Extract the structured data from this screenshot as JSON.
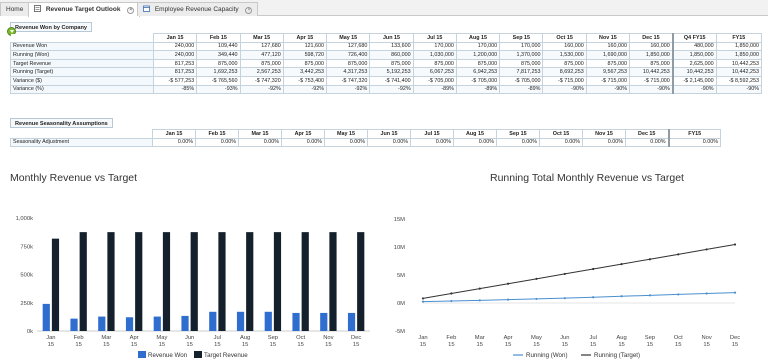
{
  "tabs": [
    {
      "label": "Home"
    },
    {
      "label": "Revenue Target Outlook"
    },
    {
      "label": "Employee Revenue Capacity"
    }
  ],
  "table1": {
    "title": "Revenue Won by Company",
    "columns": [
      "Jan 15",
      "Feb 15",
      "Mar 15",
      "Apr 15",
      "May 15",
      "Jun 15",
      "Jul 15",
      "Aug 15",
      "Sep 15",
      "Oct 15",
      "Nov 15",
      "Dec 15",
      "Q4 FY15",
      "FY15"
    ],
    "rows": [
      {
        "label": "Revenue Won",
        "values": [
          "240,000",
          "109,440",
          "127,680",
          "121,600",
          "127,680",
          "133,600",
          "170,000",
          "170,000",
          "170,000",
          "160,000",
          "160,000",
          "160,000",
          "480,000",
          "1,850,000"
        ]
      },
      {
        "label": "Running (Won)",
        "values": [
          "240,000",
          "349,440",
          "477,120",
          "598,720",
          "726,400",
          "860,000",
          "1,030,000",
          "1,200,000",
          "1,370,000",
          "1,530,000",
          "1,690,000",
          "1,850,000",
          "1,850,000",
          "1,850,000"
        ]
      },
      {
        "label": "Target Revenue",
        "values": [
          "817,253",
          "875,000",
          "875,000",
          "875,000",
          "875,000",
          "875,000",
          "875,000",
          "875,000",
          "875,000",
          "875,000",
          "875,000",
          "875,000",
          "2,625,000",
          "10,442,253"
        ]
      },
      {
        "label": "Running (Target)",
        "values": [
          "817,253",
          "1,692,253",
          "2,567,253",
          "3,442,253",
          "4,317,253",
          "5,192,253",
          "6,067,253",
          "6,942,253",
          "7,817,253",
          "8,692,253",
          "9,567,253",
          "10,442,253",
          "10,442,253",
          "10,442,253"
        ]
      },
      {
        "label": "Variance ($)",
        "values": [
          "-$ 577,253",
          "-$ 765,560",
          "-$ 747,320",
          "-$ 753,400",
          "-$ 747,320",
          "-$ 741,400",
          "-$ 705,000",
          "-$ 705,000",
          "-$ 705,000",
          "-$ 715,000",
          "-$ 715,000",
          "-$ 715,000",
          "-$ 2,145,000",
          "-$ 8,592,253"
        ]
      },
      {
        "label": "Variance (%)",
        "values": [
          "-85%",
          "-93%",
          "-92%",
          "-92%",
          "-92%",
          "-92%",
          "-89%",
          "-89%",
          "-89%",
          "-90%",
          "-90%",
          "-90%",
          "-90%",
          "-90%"
        ]
      }
    ]
  },
  "table2": {
    "title": "Revenue Seasonality Assumptions",
    "columns": [
      "Jan 15",
      "Feb 15",
      "Mar 15",
      "Apr 15",
      "May 15",
      "Jun 15",
      "Jul 15",
      "Aug 15",
      "Sep 15",
      "Oct 15",
      "Nov 15",
      "Dec 15",
      "FY15"
    ],
    "rows": [
      {
        "label": "Seasonality Adjustment",
        "values": [
          "0.00%",
          "0.00%",
          "0.00%",
          "0.00%",
          "0.00%",
          "0.00%",
          "0.00%",
          "0.00%",
          "0.00%",
          "0.00%",
          "0.00%",
          "0.00%",
          "0.00%"
        ]
      }
    ]
  },
  "chart_data": [
    {
      "type": "bar",
      "title": "Monthly Revenue vs Target",
      "categories": [
        "Jan 15",
        "Feb 15",
        "Mar 15",
        "Apr 15",
        "May 15",
        "Jun 15",
        "Jul 15",
        "Aug 15",
        "Sep 15",
        "Oct 15",
        "Nov 15",
        "Dec 15"
      ],
      "series": [
        {
          "name": "Revenue Won",
          "color": "#2f6ecf",
          "values": [
            240000,
            109440,
            127680,
            121600,
            127680,
            133600,
            170000,
            170000,
            170000,
            160000,
            160000,
            160000
          ]
        },
        {
          "name": "Target Revenue",
          "color": "#14202b",
          "values": [
            817253,
            875000,
            875000,
            875000,
            875000,
            875000,
            875000,
            875000,
            875000,
            875000,
            875000,
            875000
          ]
        }
      ],
      "ylim": [
        0,
        1000000
      ],
      "yticks": [
        "0k",
        "250k",
        "500k",
        "750k",
        "1,000k"
      ],
      "legend": "bottom"
    },
    {
      "type": "line",
      "title": "Running Total Monthly Revenue vs Target",
      "categories": [
        "Jan 15",
        "Feb 15",
        "Mar 15",
        "Apr 15",
        "May 15",
        "Jun 15",
        "Jul 15",
        "Aug 15",
        "Sep 15",
        "Oct 15",
        "Nov 15",
        "Dec 15"
      ],
      "series": [
        {
          "name": "Running (Won)",
          "color": "#4a8fcf",
          "values": [
            240000,
            349440,
            477120,
            598720,
            726400,
            860000,
            1030000,
            1200000,
            1370000,
            1530000,
            1690000,
            1850000
          ]
        },
        {
          "name": "Running (Target)",
          "color": "#333333",
          "values": [
            817253,
            1692253,
            2567253,
            3442253,
            4317253,
            5192253,
            6067253,
            6942253,
            7817253,
            8692253,
            9567253,
            10442253
          ]
        }
      ],
      "ylim": [
        -5000000,
        15000000
      ],
      "yticks": [
        "-5M",
        "0M",
        "5M",
        "10M",
        "15M"
      ],
      "legend": "bottom"
    }
  ]
}
